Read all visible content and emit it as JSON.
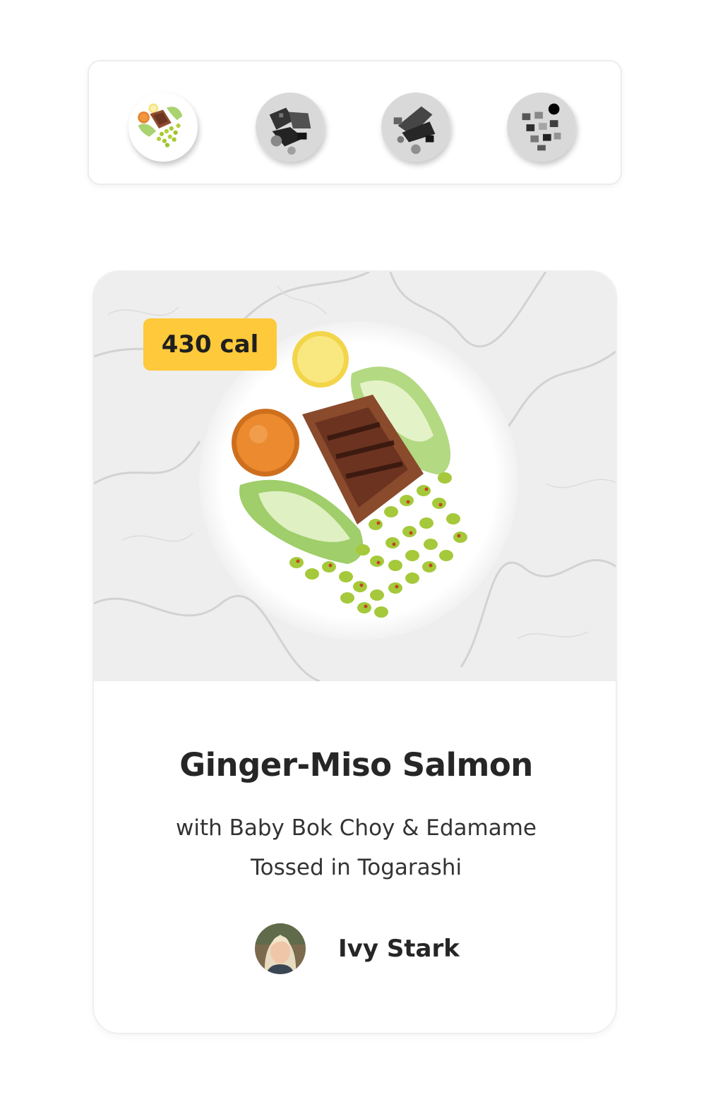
{
  "thumbnails": [
    {
      "name": "meal-thumbnail-1",
      "icon": "salmon-plate-icon",
      "selected": true
    },
    {
      "name": "meal-thumbnail-2",
      "icon": "meal-plate-icon",
      "selected": false
    },
    {
      "name": "meal-thumbnail-3",
      "icon": "meal-plate-icon",
      "selected": false
    },
    {
      "name": "meal-thumbnail-4",
      "icon": "meal-plate-icon",
      "selected": false
    }
  ],
  "meal": {
    "calories": "430 cal",
    "title": "Ginger-Miso Salmon",
    "subtitle": "with Baby Bok Choy & Edamame Tossed in Togarashi",
    "chef_name": "Ivy Stark"
  },
  "colors": {
    "badge": "#fec93a",
    "text": "#262626",
    "card_border": "#efefef"
  }
}
